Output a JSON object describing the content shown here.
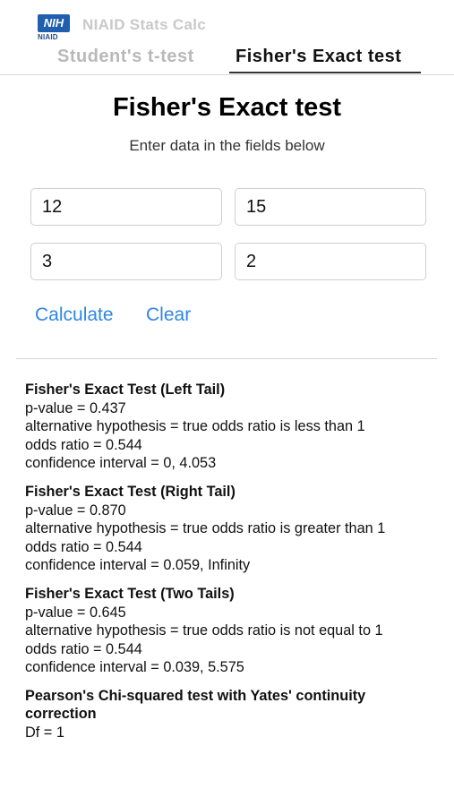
{
  "header": {
    "logo_text": "NIH",
    "logo_sub": "NIAID",
    "app_title": "NIAID Stats Calc"
  },
  "tabs": [
    {
      "label": "Student's t-test",
      "active": false
    },
    {
      "label": "Fisher's Exact test",
      "active": true
    }
  ],
  "page": {
    "title": "Fisher's Exact test",
    "subtitle": "Enter data in the fields below"
  },
  "inputs": [
    {
      "value": "12"
    },
    {
      "value": "15"
    },
    {
      "value": "3"
    },
    {
      "value": "2"
    }
  ],
  "actions": {
    "calculate_label": "Calculate",
    "clear_label": "Clear"
  },
  "results": [
    {
      "heading": "Fisher's Exact Test (Left Tail)",
      "p_value": "p-value = 0.437",
      "alternative": "alternative hypothesis = true odds ratio is less than 1",
      "odds_ratio": "odds ratio = 0.544",
      "confidence_interval": "confidence interval = 0, 4.053"
    },
    {
      "heading": "Fisher's Exact Test (Right Tail)",
      "p_value": "p-value = 0.870",
      "alternative": "alternative hypothesis = true odds ratio is greater than 1",
      "odds_ratio": "odds ratio = 0.544",
      "confidence_interval": "confidence interval = 0.059, Infinity"
    },
    {
      "heading": "Fisher's Exact Test (Two Tails)",
      "p_value": "p-value = 0.645",
      "alternative": "alternative hypothesis = true odds ratio is not equal to 1",
      "odds_ratio": "odds ratio = 0.544",
      "confidence_interval": "confidence interval = 0.039, 5.575"
    },
    {
      "heading": "Pearson's Chi-squared test with Yates' continuity correction",
      "df": "Df = 1"
    }
  ],
  "colors": {
    "accent": "#2e86e6",
    "logo_blue": "#1f5fae",
    "inactive_tab": "#b9b9b9"
  }
}
